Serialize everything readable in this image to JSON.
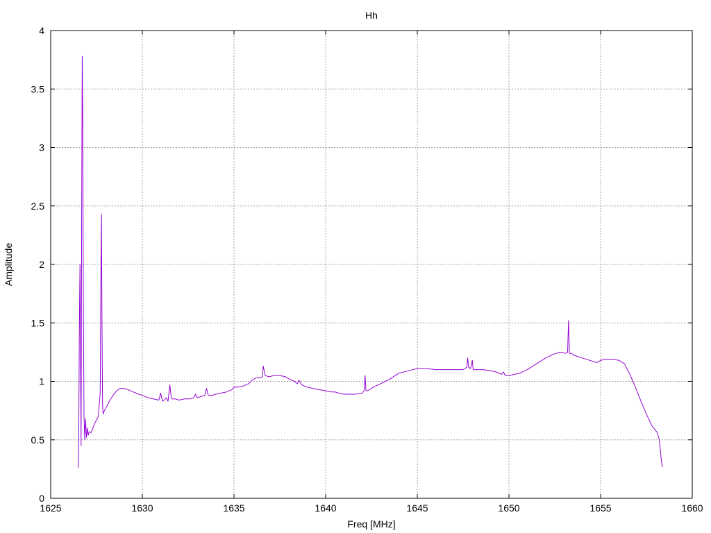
{
  "chart_data": {
    "type": "line",
    "title": "Hh",
    "xlabel": "Freq [MHz]",
    "ylabel": "Amplitude",
    "xlim": [
      1625,
      1660
    ],
    "ylim": [
      0,
      4
    ],
    "grid": true,
    "line_color": "#9400d3",
    "grid_color": "#a0a0a0",
    "x_ticks": [
      {
        "value": 1625,
        "label": "1625"
      },
      {
        "value": 1630,
        "label": "1630"
      },
      {
        "value": 1635,
        "label": "1635"
      },
      {
        "value": 1640,
        "label": "1640"
      },
      {
        "value": 1645,
        "label": "1645"
      },
      {
        "value": 1650,
        "label": "1650"
      },
      {
        "value": 1655,
        "label": "1655"
      },
      {
        "value": 1660,
        "label": "1660"
      }
    ],
    "y_ticks": [
      {
        "value": 0,
        "label": "0"
      },
      {
        "value": 0.5,
        "label": "0.5"
      },
      {
        "value": 1,
        "label": "1"
      },
      {
        "value": 1.5,
        "label": "1.5"
      },
      {
        "value": 2,
        "label": "2"
      },
      {
        "value": 2.5,
        "label": "2.5"
      },
      {
        "value": 3,
        "label": "3"
      },
      {
        "value": 3.5,
        "label": "3.5"
      },
      {
        "value": 4,
        "label": "4"
      }
    ],
    "series": [
      {
        "x": [
          1626.5,
          1626.53,
          1626.56,
          1626.6,
          1626.63,
          1626.66,
          1626.69,
          1626.72,
          1626.75,
          1626.78,
          1626.82,
          1626.86,
          1626.9,
          1626.95,
          1627.0,
          1627.05,
          1627.1,
          1627.2,
          1627.3,
          1627.4,
          1627.5,
          1627.6,
          1627.7,
          1627.74,
          1627.77,
          1627.8,
          1627.83,
          1627.86,
          1627.9,
          1628.0,
          1628.2,
          1628.4,
          1628.6,
          1628.8,
          1629.0,
          1629.2,
          1629.5,
          1629.8,
          1630.0,
          1630.3,
          1630.6,
          1630.9,
          1631.0,
          1631.1,
          1631.2,
          1631.3,
          1631.4,
          1631.5,
          1631.55,
          1631.6,
          1631.8,
          1632.0,
          1632.3,
          1632.6,
          1632.8,
          1632.9,
          1633.0,
          1633.2,
          1633.4,
          1633.5,
          1633.6,
          1633.8,
          1634.0,
          1634.3,
          1634.6,
          1634.9,
          1635.0,
          1635.2,
          1635.5,
          1635.8,
          1636.0,
          1636.2,
          1636.4,
          1636.55,
          1636.6,
          1636.7,
          1636.9,
          1637.2,
          1637.5,
          1637.8,
          1638.0,
          1638.3,
          1638.45,
          1638.55,
          1638.7,
          1639.0,
          1639.3,
          1639.6,
          1640.0,
          1640.3,
          1640.5,
          1640.7,
          1641.0,
          1641.3,
          1641.6,
          1642.0,
          1642.1,
          1642.15,
          1642.2,
          1642.3,
          1642.6,
          1643.0,
          1643.5,
          1644.0,
          1644.5,
          1645.0,
          1645.5,
          1646.0,
          1646.5,
          1647.0,
          1647.5,
          1647.7,
          1647.75,
          1647.8,
          1647.9,
          1648.0,
          1648.05,
          1648.1,
          1648.3,
          1648.6,
          1649.0,
          1649.3,
          1649.6,
          1649.7,
          1649.8,
          1650.0,
          1650.3,
          1650.6,
          1651.0,
          1651.5,
          1652.0,
          1652.4,
          1652.8,
          1653.1,
          1653.2,
          1653.25,
          1653.3,
          1653.4,
          1653.6,
          1654.0,
          1654.4,
          1654.8,
          1655.0,
          1655.3,
          1655.6,
          1656.0,
          1656.3,
          1656.6,
          1656.9,
          1657.2,
          1657.5,
          1657.8,
          1658.0,
          1658.1,
          1658.2,
          1658.3,
          1658.35,
          1658.4
        ],
        "y": [
          0.26,
          0.5,
          1.4,
          2.0,
          1.2,
          0.45,
          2.35,
          3.78,
          3.25,
          1.7,
          0.7,
          0.5,
          0.68,
          0.52,
          0.6,
          0.54,
          0.57,
          0.56,
          0.6,
          0.64,
          0.67,
          0.7,
          0.9,
          1.9,
          2.43,
          1.5,
          0.8,
          0.72,
          0.74,
          0.77,
          0.83,
          0.88,
          0.92,
          0.94,
          0.94,
          0.93,
          0.91,
          0.89,
          0.88,
          0.86,
          0.85,
          0.84,
          0.9,
          0.83,
          0.84,
          0.86,
          0.83,
          0.97,
          0.9,
          0.85,
          0.85,
          0.84,
          0.85,
          0.85,
          0.86,
          0.89,
          0.86,
          0.87,
          0.88,
          0.94,
          0.88,
          0.88,
          0.89,
          0.9,
          0.91,
          0.93,
          0.95,
          0.95,
          0.96,
          0.98,
          1.01,
          1.03,
          1.03,
          1.04,
          1.13,
          1.05,
          1.04,
          1.05,
          1.05,
          1.04,
          1.02,
          1.0,
          0.98,
          1.01,
          0.97,
          0.95,
          0.94,
          0.93,
          0.92,
          0.91,
          0.91,
          0.9,
          0.89,
          0.89,
          0.89,
          0.9,
          0.92,
          1.05,
          0.92,
          0.92,
          0.95,
          0.98,
          1.02,
          1.07,
          1.09,
          1.11,
          1.11,
          1.1,
          1.1,
          1.1,
          1.1,
          1.12,
          1.2,
          1.12,
          1.11,
          1.18,
          1.1,
          1.1,
          1.1,
          1.1,
          1.09,
          1.08,
          1.06,
          1.08,
          1.05,
          1.05,
          1.06,
          1.07,
          1.1,
          1.15,
          1.2,
          1.23,
          1.25,
          1.24,
          1.25,
          1.52,
          1.24,
          1.24,
          1.22,
          1.2,
          1.18,
          1.16,
          1.18,
          1.19,
          1.19,
          1.18,
          1.15,
          1.06,
          0.95,
          0.83,
          0.72,
          0.62,
          0.58,
          0.56,
          0.5,
          0.35,
          0.28,
          0.27
        ]
      }
    ]
  }
}
